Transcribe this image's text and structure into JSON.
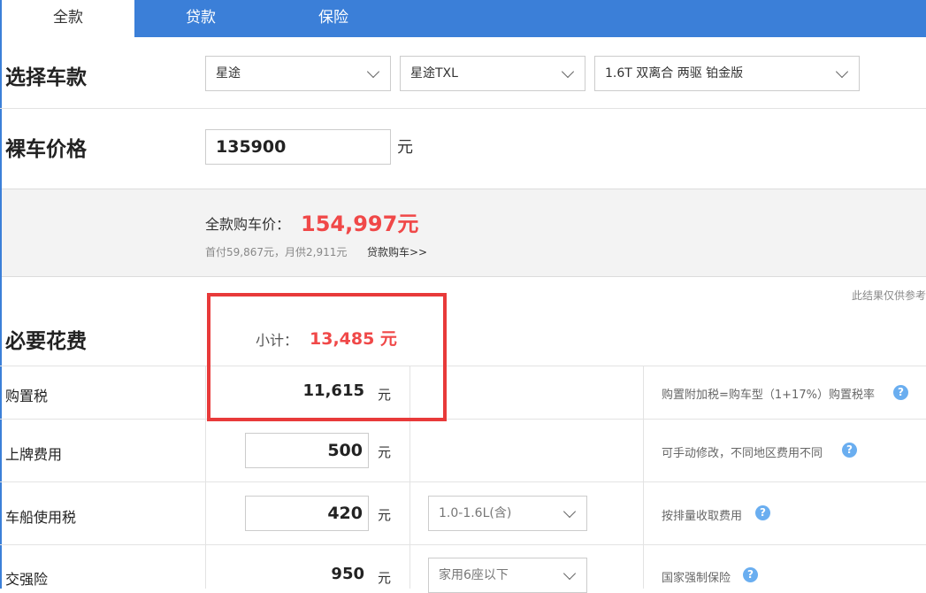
{
  "tabs": [
    {
      "label": "全款"
    },
    {
      "label": "贷款"
    },
    {
      "label": "保险"
    }
  ],
  "select_model": {
    "title": "选择车款",
    "brand": "星途",
    "series": "星途TXL",
    "trim": "1.6T 双离合 两驱 铂金版"
  },
  "bare_price": {
    "title": "裸车价格",
    "value": "135900",
    "unit": "元"
  },
  "summary": {
    "total_label": "全款购车价：",
    "total_value": "154,997元",
    "loan_info": "首付59,867元，月供2,911元",
    "loan_link": "贷款购车>>"
  },
  "disclaimer": "此结果仅供参考",
  "required": {
    "title": "必要花费",
    "subtotal_label": "小计：",
    "subtotal_value": "13,485 元",
    "rows": [
      {
        "label": "购置税",
        "value": "11,615",
        "unit": "元",
        "note": "购置附加税=购车型（1+17%）购置税率"
      },
      {
        "label": "上牌费用",
        "value": "500",
        "unit": "元",
        "note": "可手动修改，不同地区费用不同"
      },
      {
        "label": "车船使用税",
        "value": "420",
        "unit": "元",
        "option": "1.0-1.6L(含)",
        "note": "按排量收取费用"
      },
      {
        "label": "交强险",
        "value": "950",
        "unit": "元",
        "option": "家用6座以下",
        "note": "国家强制保险"
      }
    ]
  },
  "help_icon_glyph": "?",
  "colors": {
    "tab_blue": "#3b7fd8",
    "price_red": "#f04848",
    "highlight_box": "#e83a3a",
    "help_icon": "#6aaef0"
  }
}
